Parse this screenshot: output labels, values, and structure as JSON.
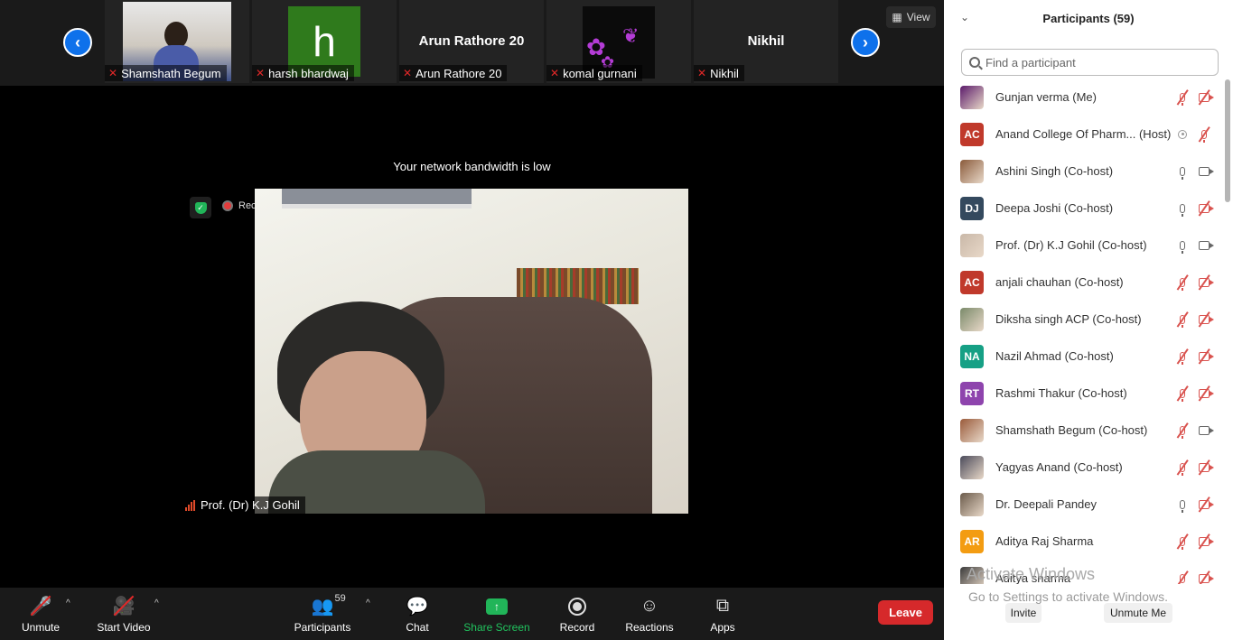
{
  "strip": {
    "tiles": [
      {
        "name": "Shamshath Begum"
      },
      {
        "name": "harsh bhardwaj",
        "initial": "h"
      },
      {
        "name": "Arun Rathore 20",
        "display": "Arun Rathore 20"
      },
      {
        "name": "komal gurnani"
      },
      {
        "name": "Nikhil",
        "display": "Nikhil"
      }
    ]
  },
  "view_label": "View",
  "notice": "Your network bandwidth is low",
  "recording_label": "Recording",
  "active_speaker": "Prof. (Dr) K.J Gohil",
  "toolbar": {
    "unmute": "Unmute",
    "start_video": "Start Video",
    "participants": "Participants",
    "participants_count": "59",
    "chat": "Chat",
    "share_screen": "Share Screen",
    "record": "Record",
    "reactions": "Reactions",
    "apps": "Apps",
    "leave": "Leave"
  },
  "panel": {
    "title": "Participants (59)",
    "search_placeholder": "Find a participant",
    "participants": [
      {
        "name": "Gunjan verma (Me)",
        "avatar": "image",
        "color": "#5a1a6a",
        "mic": "muted",
        "video": "off"
      },
      {
        "name": "Anand College Of Pharm...  (Host)",
        "initials": "AC",
        "color": "#c0392b",
        "mic": "target",
        "video": "muted-mic"
      },
      {
        "name": "Ashini Singh (Co-host)",
        "avatar": "image",
        "color": "#8a5a3a",
        "mic": "on",
        "video": "on"
      },
      {
        "name": "Deepa Joshi (Co-host)",
        "initials": "DJ",
        "color": "#34495e",
        "mic": "on",
        "video": "off"
      },
      {
        "name": "Prof. (Dr) K.J Gohil (Co-host)",
        "avatar": "image",
        "color": "#c9b8a8",
        "mic": "on",
        "video": "on"
      },
      {
        "name": "anjali chauhan (Co-host)",
        "initials": "AC",
        "color": "#c0392b",
        "mic": "muted",
        "video": "off"
      },
      {
        "name": "Diksha singh ACP (Co-host)",
        "avatar": "image",
        "color": "#7a8a6a",
        "mic": "muted",
        "video": "off"
      },
      {
        "name": "Nazil Ahmad (Co-host)",
        "initials": "NA",
        "color": "#16a085",
        "mic": "muted",
        "video": "off"
      },
      {
        "name": "Rashmi Thakur (Co-host)",
        "initials": "RT",
        "color": "#8e44ad",
        "mic": "muted",
        "video": "off"
      },
      {
        "name": "Shamshath Begum (Co-host)",
        "avatar": "image",
        "color": "#9a5a3a",
        "mic": "muted",
        "video": "on"
      },
      {
        "name": "Yagyas Anand (Co-host)",
        "avatar": "image",
        "color": "#4a4a5a",
        "mic": "muted",
        "video": "off"
      },
      {
        "name": "Dr. Deepali Pandey",
        "avatar": "image",
        "color": "#6a5a4a",
        "mic": "on",
        "video": "off"
      },
      {
        "name": "Aditya Raj Sharma",
        "initials": "AR",
        "color": "#f39c12",
        "mic": "muted",
        "video": "off"
      },
      {
        "name": "Aditya sharma",
        "avatar": "image",
        "color": "#3a3a3a",
        "mic": "muted",
        "video": "off"
      }
    ],
    "invite": "Invite",
    "unmute_me": "Unmute Me"
  },
  "watermark": {
    "line1": "Activate Windows",
    "line2": "Go to Settings to activate Windows."
  }
}
